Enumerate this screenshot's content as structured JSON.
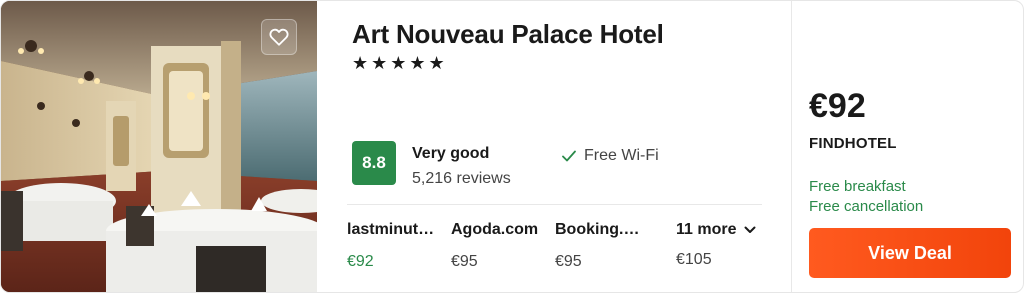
{
  "hotel": {
    "name": "Art Nouveau Palace Hotel",
    "stars": "★★★★★",
    "star_count": 5,
    "favorite_icon": "heart-icon"
  },
  "rating": {
    "score": "8.8",
    "label": "Very good",
    "reviews": "5,216 reviews",
    "color": "#2a8a4a"
  },
  "amenities": [
    {
      "icon": "check-icon",
      "label": "Free Wi-Fi"
    }
  ],
  "deals": [
    {
      "provider": "lastminut…",
      "price": "€92",
      "best": true
    },
    {
      "provider": "Agoda.com",
      "price": "€95",
      "best": false
    },
    {
      "provider": "Booking.c…",
      "price": "€95",
      "best": false
    }
  ],
  "more": {
    "label": "11 more",
    "price": "€105",
    "icon": "chevron-down-icon"
  },
  "offer": {
    "price": "€92",
    "provider": "FINDHOTEL",
    "perks": [
      "Free breakfast",
      "Free cancellation"
    ],
    "button_label": "View Deal",
    "button_color": "#ff5a1f",
    "perk_color": "#2a8a4a"
  }
}
